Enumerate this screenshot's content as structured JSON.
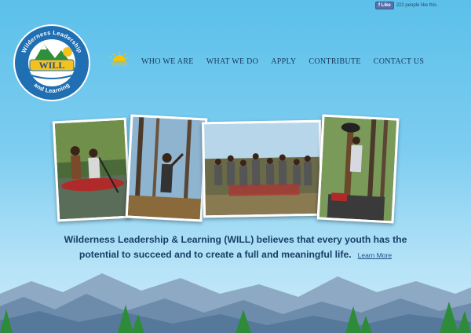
{
  "facebook": {
    "button_label": "Like",
    "like_text": "222 people like this."
  },
  "logo": {
    "top_text": "Wilderness Leadership",
    "center_text": "WILL",
    "bottom_text": "and Learning"
  },
  "nav": {
    "home_label": "HOME",
    "items": [
      "WHO WE ARE",
      "WHAT WE DO",
      "APPLY",
      "CONTRIBUTE",
      "CONTACT US"
    ]
  },
  "tagline": {
    "line1": "Wilderness Leadership & Learning (WILL) believes that every youth has the",
    "line2": "potential to succeed and to create a full and meaningful life.",
    "link_label": "Learn More"
  },
  "colors": {
    "sky": "#5bc0ea",
    "nav_text": "#163a5e",
    "home_gold": "#f1c40f",
    "tagline": "#173f66"
  }
}
